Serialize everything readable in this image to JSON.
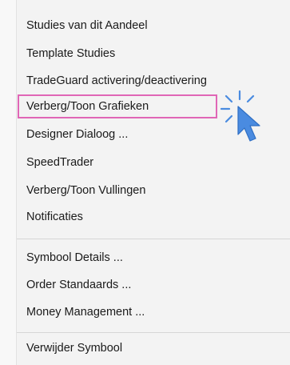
{
  "menu": {
    "items": [
      {
        "label": "Studies van dit Aandeel"
      },
      {
        "label": "Template Studies"
      },
      {
        "label": "TradeGuard activering/deactivering"
      },
      {
        "label": "Verberg/Toon Grafieken"
      },
      {
        "label": "Designer Dialoog ..."
      },
      {
        "label": "SpeedTrader"
      },
      {
        "label": "Verberg/Toon Vullingen"
      },
      {
        "label": "Notificaties"
      },
      {
        "label": "Symbool Details ..."
      },
      {
        "label": "Order Standaards ..."
      },
      {
        "label": "Money Management ..."
      },
      {
        "label": "Verwijder Symbool"
      }
    ],
    "highlighted_item": "Verberg/Toon Grafieken"
  },
  "colors": {
    "highlight_border": "#e066b6",
    "cursor": "#4a8be0",
    "menu_background": "#f3f3f3"
  },
  "icons": {
    "cursor": "mouse-pointer-icon",
    "click_burst": "click-burst-icon"
  }
}
